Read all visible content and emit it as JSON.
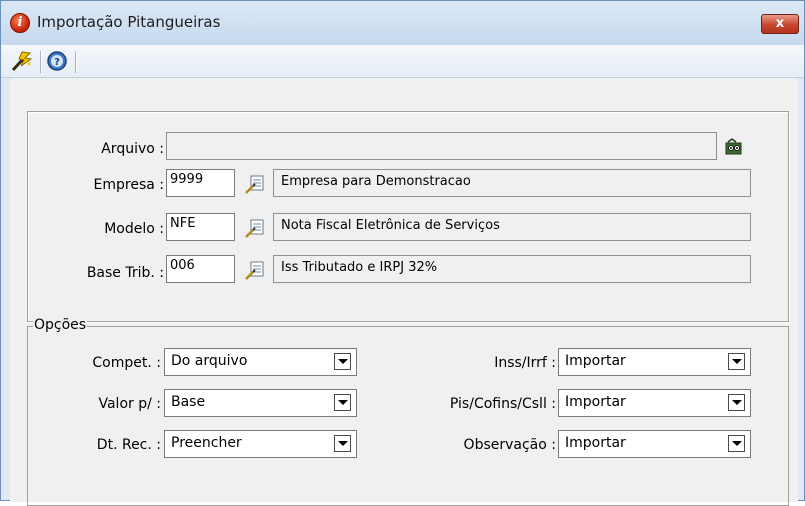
{
  "window": {
    "title": "Importação Pitangueiras",
    "close_label": "x"
  },
  "toolbar": {
    "execute_icon": "lightning-wand-icon",
    "help_icon": "question-icon"
  },
  "form": {
    "arquivo_label": "Arquivo :",
    "arquivo_value": "",
    "empresa_label": "Empresa :",
    "empresa_code": "9999",
    "empresa_desc": "Empresa para Demonstracao",
    "modelo_label": "Modelo :",
    "modelo_code": "NFE",
    "modelo_desc": "Nota Fiscal Eletrônica de Serviços",
    "base_label": "Base Trib. :",
    "base_code": "006",
    "base_desc": "Iss Tributado e IRPJ 32%"
  },
  "opcoes": {
    "title": "Opções",
    "compet_label": "Compet. :",
    "compet_value": "Do arquivo",
    "valor_label": "Valor p/ :",
    "valor_value": "Base",
    "dtrec_label": "Dt. Rec. :",
    "dtrec_value": "Preencher",
    "inss_label": "Inss/Irrf :",
    "inss_value": "Importar",
    "pis_label": "Pis/Cofins/Csll :",
    "pis_value": "Importar",
    "obs_label": "Observação :",
    "obs_value": "Importar"
  }
}
